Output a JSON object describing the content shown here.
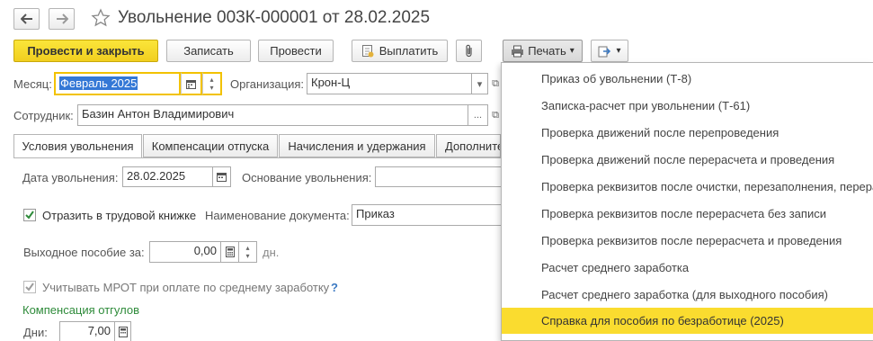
{
  "window": {
    "title": "Увольнение 003К-000001 от 28.02.2025"
  },
  "icons": {
    "back": "arrow-left-icon",
    "forward": "arrow-right-icon",
    "favorite": "star-icon",
    "attach": "paperclip-icon",
    "print": "printer-icon",
    "pay": "document-icon",
    "more": "export-icon",
    "calendar": "calendar-icon",
    "dropdown": "chevron-down-icon",
    "open": "open-form-icon"
  },
  "toolbar": {
    "post_close_label": "Провести и закрыть",
    "save_label": "Записать",
    "post_label": "Провести",
    "pay_label": "Выплатить",
    "print_label": "Печать",
    "dropdown_glyph": "▾"
  },
  "form": {
    "month_label": "Месяц:",
    "month_value": "Февраль 2025",
    "org_label": "Организация:",
    "org_value": "Крон-Ц",
    "employee_label": "Сотрудник:",
    "employee_value": "Базин Антон Владимирович",
    "ellipsis": "...",
    "open_glyph": "⧉"
  },
  "tabs": [
    {
      "label": "Условия увольнения",
      "active": true
    },
    {
      "label": "Компенсации отпуска",
      "active": false
    },
    {
      "label": "Начисления и удержания",
      "active": false
    },
    {
      "label": "Дополнительно",
      "active": false
    }
  ],
  "conditions": {
    "dismissal_date_label": "Дата увольнения:",
    "dismissal_date_value": "28.02.2025",
    "reason_label": "Основание увольнения:",
    "reason_value": "",
    "workbook_label": "Отразить в трудовой книжке",
    "workbook_checked": true,
    "doc_name_label": "Наименование документа:",
    "doc_name_value": "Приказ",
    "severance_label": "Выходное пособие за:",
    "severance_value": "0,00",
    "severance_unit": "дн.",
    "mrot_label": "Учитывать МРОТ при оплате по среднему заработку",
    "mrot_checked": true,
    "help_glyph": "?",
    "vacation_comp_header": "Компенсация отгулов",
    "days_label": "Дни:",
    "days_value": "7,00"
  },
  "print_menu": {
    "items": [
      {
        "label": "Приказ об увольнении (Т-8)",
        "selected": false
      },
      {
        "label": "Записка-расчет при увольнении (Т-61)",
        "selected": false
      },
      {
        "label": "Проверка движений после перепроведения",
        "selected": false
      },
      {
        "label": "Проверка движений после перерасчета и проведения",
        "selected": false
      },
      {
        "label": "Проверка реквизитов после очистки, перезаполнения, перерасчета",
        "selected": false
      },
      {
        "label": "Проверка реквизитов после перерасчета без записи",
        "selected": false
      },
      {
        "label": "Проверка реквизитов после перерасчета и проведения",
        "selected": false
      },
      {
        "label": "Расчет среднего заработка",
        "selected": false
      },
      {
        "label": "Расчет среднего заработка (для выходного пособия)",
        "selected": false
      },
      {
        "label": "Справка для пособия по безработице (2025)",
        "selected": true
      }
    ]
  },
  "colors": {
    "primary_button": "#f5d82a",
    "selected_item": "#fadc2f",
    "focus_border": "#f2c200",
    "section_header": "#2e8b3a"
  }
}
